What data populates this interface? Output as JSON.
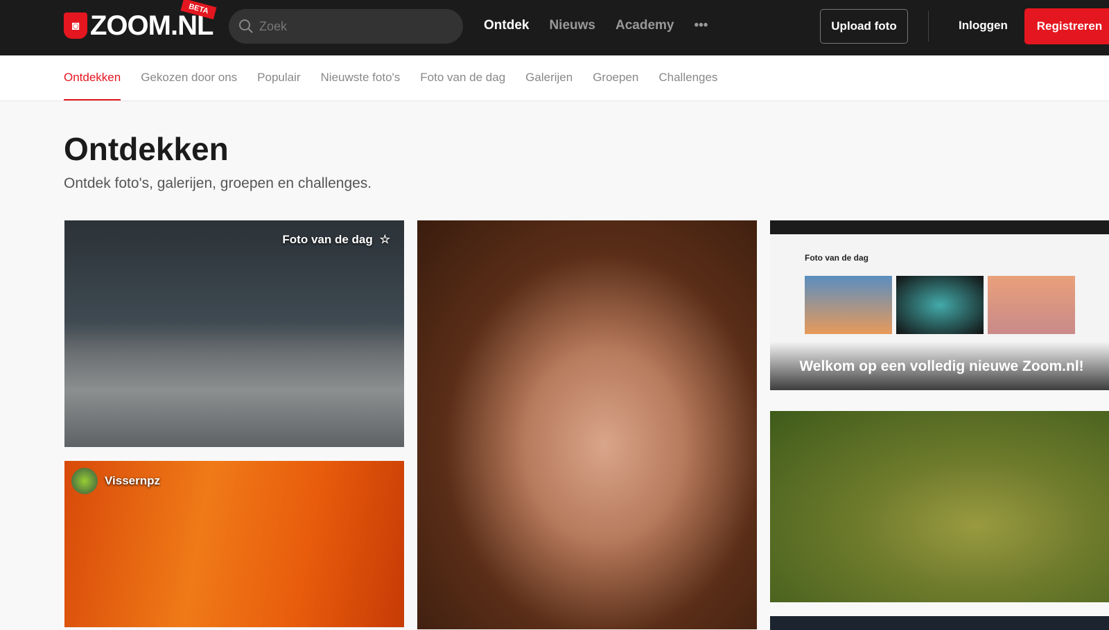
{
  "header": {
    "logo_text": "ZOOM.NL",
    "beta_badge": "BETA",
    "search_placeholder": "Zoek",
    "nav": [
      {
        "label": "Ontdek"
      },
      {
        "label": "Nieuws"
      },
      {
        "label": "Academy"
      },
      {
        "label": "•••"
      }
    ],
    "upload_label": "Upload foto",
    "login_label": "Inloggen",
    "register_label": "Registreren"
  },
  "subnav": [
    {
      "label": "Ontdekken"
    },
    {
      "label": "Gekozen door ons"
    },
    {
      "label": "Populair"
    },
    {
      "label": "Nieuwste foto's"
    },
    {
      "label": "Foto van de dag"
    },
    {
      "label": "Galerijen"
    },
    {
      "label": "Groepen"
    },
    {
      "label": "Challenges"
    }
  ],
  "page": {
    "title": "Ontdekken",
    "subtitle": "Ontdek foto's, galerijen, groepen en challenges."
  },
  "cards": {
    "photo_of_day_label": "Foto van de dag",
    "user_name": "Vissernpz",
    "welcome_text": "Welkom op een volledig nieuwe Zoom.nl!",
    "mini_title": "Foto van de dag"
  },
  "colors": {
    "accent": "#e4161f",
    "header_bg": "#1b1b1b"
  }
}
